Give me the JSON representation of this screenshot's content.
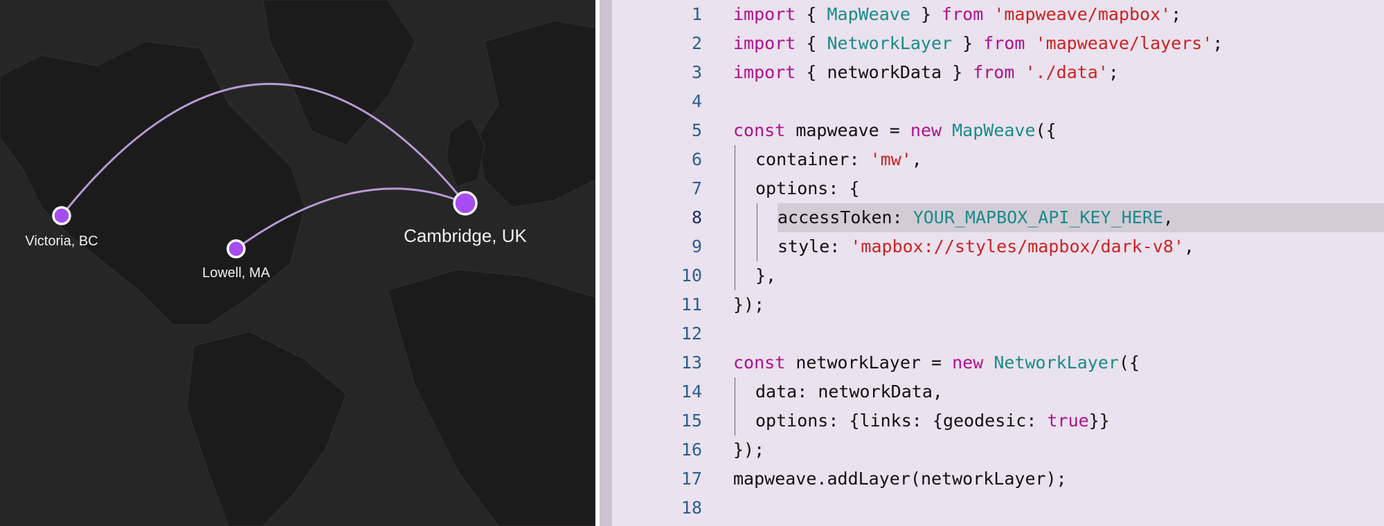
{
  "map": {
    "style": "dark",
    "background_color": "#262626",
    "land_color": "#1b1b1b",
    "edge_color": "#b79ad4",
    "node_color": "#a64df2",
    "node_stroke": "#ffffff",
    "nodes": [
      {
        "id": "victoria",
        "label": "Victoria, BC",
        "size": "small"
      },
      {
        "id": "lowell",
        "label": "Lowell, MA",
        "size": "small"
      },
      {
        "id": "cambridge",
        "label": "Cambridge, UK",
        "size": "large"
      }
    ],
    "edges": [
      {
        "from": "victoria",
        "to": "cambridge"
      },
      {
        "from": "lowell",
        "to": "cambridge"
      }
    ]
  },
  "editor": {
    "highlighted_line": 8,
    "colors": {
      "background": "#eae2ee",
      "keyword": "#b0108f",
      "type": "#1a8a8a",
      "string": "#cc2222",
      "line_number": "#2b5f8e"
    },
    "lines": [
      {
        "num": "1",
        "indent": 0,
        "tokens": [
          [
            "keyword",
            "import"
          ],
          [
            "punct",
            " { "
          ],
          [
            "type",
            "MapWeave"
          ],
          [
            "punct",
            " } "
          ],
          [
            "keyword",
            "from"
          ],
          [
            "punct",
            " "
          ],
          [
            "string",
            "'mapweave/mapbox'"
          ],
          [
            "punct",
            ";"
          ]
        ]
      },
      {
        "num": "2",
        "indent": 0,
        "tokens": [
          [
            "keyword",
            "import"
          ],
          [
            "punct",
            " { "
          ],
          [
            "type",
            "NetworkLayer"
          ],
          [
            "punct",
            " } "
          ],
          [
            "keyword",
            "from"
          ],
          [
            "punct",
            " "
          ],
          [
            "string",
            "'mapweave/layers'"
          ],
          [
            "punct",
            ";"
          ]
        ]
      },
      {
        "num": "3",
        "indent": 0,
        "tokens": [
          [
            "keyword",
            "import"
          ],
          [
            "punct",
            " { "
          ],
          [
            "ident",
            "networkData"
          ],
          [
            "punct",
            " } "
          ],
          [
            "keyword",
            "from"
          ],
          [
            "punct",
            " "
          ],
          [
            "string",
            "'./data'"
          ],
          [
            "punct",
            ";"
          ]
        ]
      },
      {
        "num": "4",
        "indent": 0,
        "tokens": []
      },
      {
        "num": "5",
        "indent": 0,
        "tokens": [
          [
            "keyword",
            "const"
          ],
          [
            "punct",
            " "
          ],
          [
            "ident",
            "mapweave"
          ],
          [
            "punct",
            " = "
          ],
          [
            "keyword",
            "new"
          ],
          [
            "punct",
            " "
          ],
          [
            "type",
            "MapWeave"
          ],
          [
            "punct",
            "({"
          ]
        ]
      },
      {
        "num": "6",
        "indent": 1,
        "tokens": [
          [
            "ident",
            "container"
          ],
          [
            "punct",
            ": "
          ],
          [
            "string",
            "'mw'"
          ],
          [
            "punct",
            ","
          ]
        ]
      },
      {
        "num": "7",
        "indent": 1,
        "tokens": [
          [
            "ident",
            "options"
          ],
          [
            "punct",
            ": {"
          ]
        ]
      },
      {
        "num": "8",
        "indent": 2,
        "tokens": [
          [
            "ident",
            "accessToken"
          ],
          [
            "punct",
            ": "
          ],
          [
            "type",
            "YOUR_MAPBOX_API_KEY_HERE"
          ],
          [
            "punct",
            ","
          ]
        ]
      },
      {
        "num": "9",
        "indent": 2,
        "tokens": [
          [
            "ident",
            "style"
          ],
          [
            "punct",
            ": "
          ],
          [
            "string",
            "'mapbox://styles/mapbox/dark-v8'"
          ],
          [
            "punct",
            ","
          ]
        ]
      },
      {
        "num": "10",
        "indent": 1,
        "tokens": [
          [
            "punct",
            "},"
          ]
        ]
      },
      {
        "num": "11",
        "indent": 0,
        "tokens": [
          [
            "punct",
            "});"
          ]
        ]
      },
      {
        "num": "12",
        "indent": 0,
        "tokens": []
      },
      {
        "num": "13",
        "indent": 0,
        "tokens": [
          [
            "keyword",
            "const"
          ],
          [
            "punct",
            " "
          ],
          [
            "ident",
            "networkLayer"
          ],
          [
            "punct",
            " = "
          ],
          [
            "keyword",
            "new"
          ],
          [
            "punct",
            " "
          ],
          [
            "type",
            "NetworkLayer"
          ],
          [
            "punct",
            "({"
          ]
        ]
      },
      {
        "num": "14",
        "indent": 1,
        "tokens": [
          [
            "ident",
            "data"
          ],
          [
            "punct",
            ": "
          ],
          [
            "ident",
            "networkData"
          ],
          [
            "punct",
            ","
          ]
        ]
      },
      {
        "num": "15",
        "indent": 1,
        "tokens": [
          [
            "ident",
            "options"
          ],
          [
            "punct",
            ": {"
          ],
          [
            "ident",
            "links"
          ],
          [
            "punct",
            ": {"
          ],
          [
            "ident",
            "geodesic"
          ],
          [
            "punct",
            ": "
          ],
          [
            "keyword",
            "true"
          ],
          [
            "punct",
            "}}"
          ]
        ]
      },
      {
        "num": "16",
        "indent": 0,
        "tokens": [
          [
            "punct",
            "});"
          ]
        ]
      },
      {
        "num": "17",
        "indent": 0,
        "tokens": [
          [
            "ident",
            "mapweave.addLayer"
          ],
          [
            "punct",
            "("
          ],
          [
            "ident",
            "networkLayer"
          ],
          [
            "punct",
            ");"
          ]
        ]
      },
      {
        "num": "18",
        "indent": 0,
        "tokens": []
      }
    ]
  }
}
